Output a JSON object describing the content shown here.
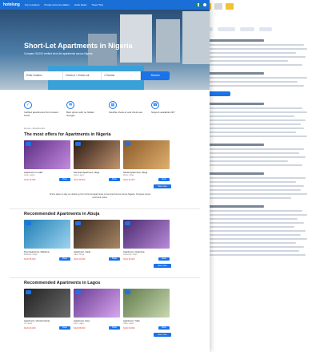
{
  "nav": {
    "logo": "hotelsng",
    "items": [
      "Top Locations",
      "Private Accommodation",
      "Hotel Deals",
      "Travel Tips"
    ],
    "colors": {
      "bar": "#1a6fd6"
    }
  },
  "hero": {
    "title": "Short-Let Apartments in Nigeria",
    "subtitle": "Compare 30,000 verified short-let apartments across Nigeria",
    "search": {
      "location_placeholder": "Enter location",
      "dates": "Check-in / Check-out",
      "guests": "2 Guests",
      "button": "Search"
    }
  },
  "features": [
    {
      "icon": "shield-icon",
      "text": "Verified apartments from trusted hosts"
    },
    {
      "icon": "tag-icon",
      "text": "Best prices with no hidden charges"
    },
    {
      "icon": "calendar-icon",
      "text": "Flexible check-in and check-out"
    },
    {
      "icon": "headset-icon",
      "text": "Support available 24/7"
    }
  ],
  "breadcrumb": "Home › Apartments",
  "sections": [
    {
      "title": "The most offers for Apartments in Nigeria",
      "cards": [
        {
          "name": "Apartment in Lekki",
          "location": "Lekki, Lagos",
          "price": "NGN 45,000",
          "book": "Book"
        },
        {
          "name": "Serviced Apartment, Ikeja",
          "location": "Ikeja, Lagos",
          "price": "NGN 38,000",
          "book": "Book"
        },
        {
          "name": "Studio Apartment, Abuja",
          "location": "Wuse, Abuja",
          "price": "NGN 32,000",
          "book": "Book"
        }
      ],
      "more": "See more",
      "note": "Find a place to stay on Hotels.ng from short-let apartments to serviced homes across Nigeria. Compare prices and book online."
    },
    {
      "title": "Recommended Apartments in Abuja",
      "cards": [
        {
          "name": "Pool Apartment, Maitama",
          "location": "Maitama, Abuja",
          "price": "NGN 55,000",
          "book": "Book"
        },
        {
          "name": "Apartment, Garki",
          "location": "Garki, Abuja",
          "price": "NGN 40,000",
          "book": "Book"
        },
        {
          "name": "Apartment, Gwarinpa",
          "location": "Gwarinpa, Abuja",
          "price": "NGN 35,000",
          "book": "Book"
        }
      ],
      "more": "See more"
    },
    {
      "title": "Recommended Apartments in Lagos",
      "cards": [
        {
          "name": "Apartment, Victoria Island",
          "location": "VI, Lagos",
          "price": "NGN 60,000",
          "book": "Book"
        },
        {
          "name": "Apartment, Ikoyi",
          "location": "Ikoyi, Lagos",
          "price": "NGN 58,000",
          "book": "Book"
        },
        {
          "name": "Apartment, Yaba",
          "location": "Yaba, Lagos",
          "price": "NGN 30,000",
          "book": "Book"
        }
      ],
      "more": "See more"
    }
  ]
}
